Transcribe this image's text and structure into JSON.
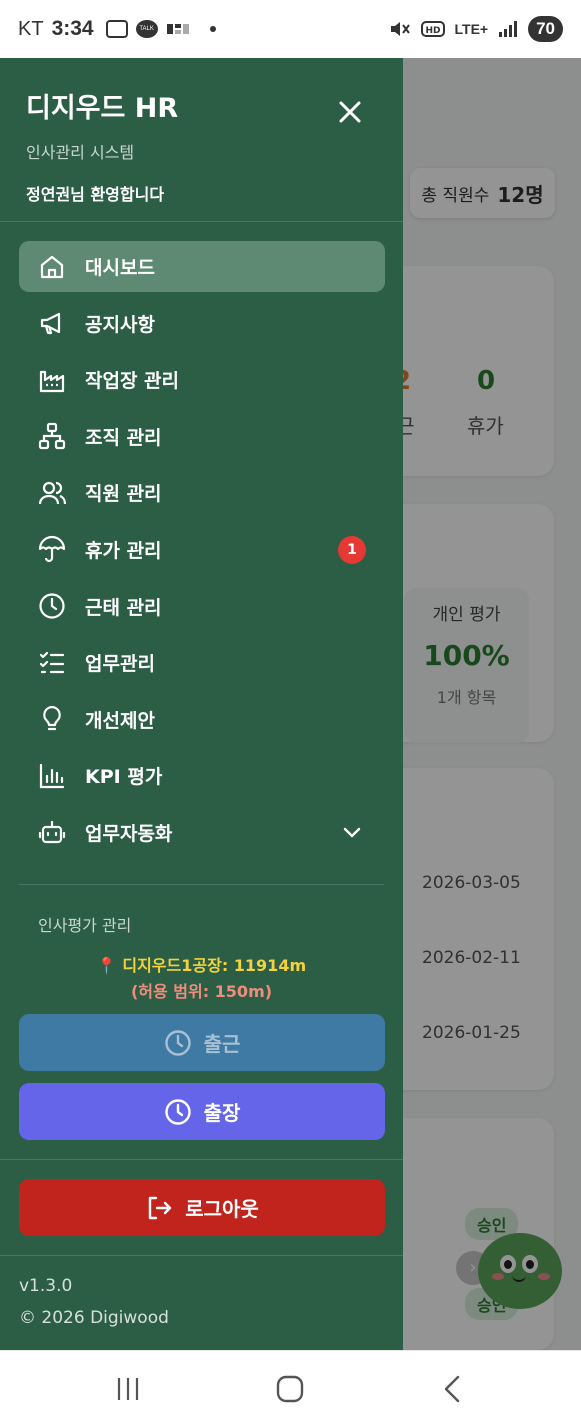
{
  "status_bar": {
    "carrier": "KT",
    "time": "3:34",
    "talk_label": "TALK",
    "network": "LTE+",
    "battery": "70",
    "icons": [
      "screenshot-icon",
      "kakaotalk-icon",
      "mute-icon",
      "hd-icon",
      "lte-icon",
      "signal-icon",
      "battery-icon"
    ]
  },
  "background": {
    "staff_chip": {
      "label": "총 직원수",
      "value": "12명"
    },
    "attendance": {
      "partial_value": "2",
      "partial_label": "근",
      "leave_value": "0",
      "leave_label": "휴가"
    },
    "evaluation": {
      "label": "개인 평가",
      "value": "100%",
      "items": "1개 항목"
    },
    "dates": [
      "2026-03-05",
      "2026-02-11",
      "2026-01-25"
    ],
    "badges": [
      "승인",
      "승인"
    ]
  },
  "drawer": {
    "title": "디지우드 HR",
    "subtitle": "인사관리 시스템",
    "welcome": "정연권님 환영합니다",
    "nav": [
      {
        "label": "대시보드",
        "icon": "home-icon",
        "active": true
      },
      {
        "label": "공지사항",
        "icon": "megaphone-icon"
      },
      {
        "label": "작업장 관리",
        "icon": "factory-icon"
      },
      {
        "label": "조직 관리",
        "icon": "org-chart-icon"
      },
      {
        "label": "직원 관리",
        "icon": "users-icon"
      },
      {
        "label": "휴가 관리",
        "icon": "umbrella-icon",
        "badge": "1"
      },
      {
        "label": "근태 관리",
        "icon": "clock-icon"
      },
      {
        "label": "업무관리",
        "icon": "checklist-icon"
      },
      {
        "label": "개선제안",
        "icon": "lightbulb-icon"
      },
      {
        "label": "KPI 평가",
        "icon": "bar-chart-icon"
      },
      {
        "label": "업무자동화",
        "icon": "bot-icon",
        "expandable": true
      }
    ],
    "section_title": "인사평가 관리",
    "location": "📍 디지우드1공장: 11914m",
    "allowed_range": "(허용 범위: 150m)",
    "checkin_label": "출근",
    "business_trip_label": "출장",
    "logout_label": "로그아웃",
    "version": "v1.3.0",
    "copyright": "© 2026 Digiwood"
  },
  "colors": {
    "drawer_bg": "#2c5e46",
    "active_item": "#5e8a74",
    "badge": "#e53935",
    "checkin": "#3e7aa3",
    "trip": "#6465e8",
    "logout": "#c0241c",
    "location_text": "#f3d23b",
    "range_text": "#ef8d7d"
  }
}
